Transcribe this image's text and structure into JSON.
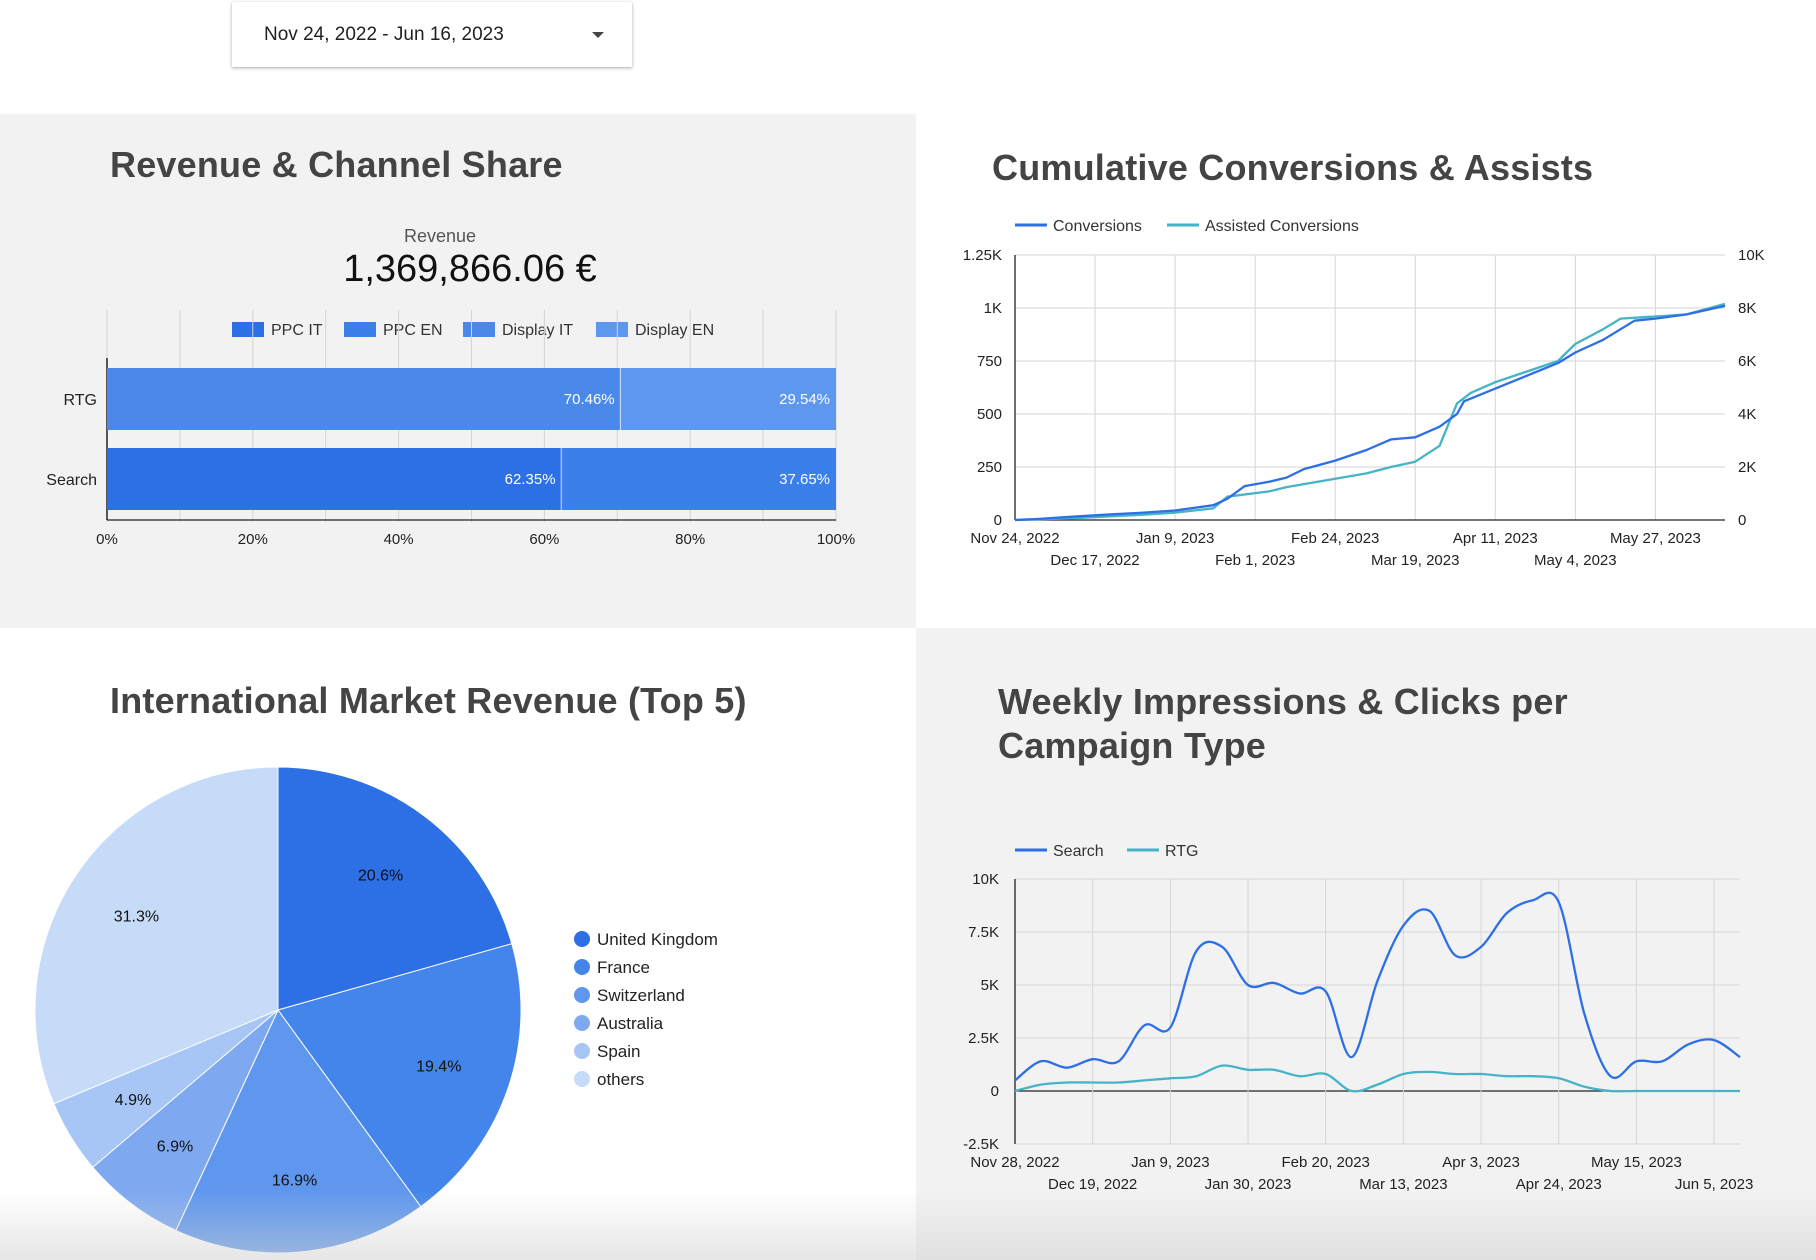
{
  "date_range": {
    "label": "Nov 24, 2022 - Jun 16, 2023"
  },
  "panels": {
    "revenue": {
      "title": "Revenue & Channel Share",
      "scorecard_label": "Revenue",
      "scorecard_value": "1,369,866.06 €"
    },
    "cumulative": {
      "title": "Cumulative Conversions & Assists"
    },
    "market": {
      "title": "International Market Revenue (Top 5)"
    },
    "weekly": {
      "title": "Weekly Impressions & Clicks per Campaign Type"
    }
  },
  "colors": {
    "ppc_it": "#2d6fe5",
    "ppc_en": "#3b7fe8",
    "display_it": "#4a89ea",
    "display_en": "#5e97ee",
    "conversions": "#2d6fe5",
    "assists": "#46b3c7",
    "search": "#2d6fe5",
    "rtg": "#46b3c7",
    "pie": [
      "#2d6fe5",
      "#4385ea",
      "#5f97ee",
      "#7ea9f0",
      "#a7c6f5",
      "#c6dbf8"
    ]
  },
  "chart_data": [
    {
      "id": "channel_share",
      "type": "bar",
      "orientation": "horizontal",
      "stacked": "percent",
      "legend": [
        "PPC IT",
        "PPC EN",
        "Display IT",
        "Display EN"
      ],
      "legend_position": "top",
      "categories": [
        "RTG",
        "Search"
      ],
      "rows": [
        {
          "category": "RTG",
          "segments": [
            {
              "series": "Display IT",
              "value": 70.46,
              "label": "70.46%"
            },
            {
              "series": "Display EN",
              "value": 29.54,
              "label": "29.54%"
            }
          ]
        },
        {
          "category": "Search",
          "segments": [
            {
              "series": "PPC IT",
              "value": 62.35,
              "label": "62.35%"
            },
            {
              "series": "PPC EN",
              "value": 37.65,
              "label": "37.65%"
            }
          ]
        }
      ],
      "x_ticks": [
        "0%",
        "20%",
        "40%",
        "60%",
        "80%",
        "100%"
      ],
      "xlim": [
        0,
        100
      ],
      "grid": true
    },
    {
      "id": "cumulative",
      "type": "line",
      "legend_position": "top-left",
      "series": [
        {
          "name": "Conversions",
          "axis": "left",
          "points": [
            [
              "2022-11-24",
              0
            ],
            [
              "2022-12-01",
              5
            ],
            [
              "2022-12-10",
              15
            ],
            [
              "2022-12-20",
              25
            ],
            [
              "2022-12-31",
              35
            ],
            [
              "2023-01-09",
              45
            ],
            [
              "2023-01-20",
              70
            ],
            [
              "2023-01-24",
              100
            ],
            [
              "2023-01-29",
              160
            ],
            [
              "2023-02-05",
              180
            ],
            [
              "2023-02-10",
              200
            ],
            [
              "2023-02-15",
              240
            ],
            [
              "2023-02-24",
              280
            ],
            [
              "2023-03-05",
              330
            ],
            [
              "2023-03-12",
              380
            ],
            [
              "2023-03-19",
              390
            ],
            [
              "2023-03-26",
              440
            ],
            [
              "2023-03-31",
              500
            ],
            [
              "2023-04-02",
              560
            ],
            [
              "2023-04-11",
              620
            ],
            [
              "2023-04-20",
              680
            ],
            [
              "2023-04-29",
              740
            ],
            [
              "2023-05-04",
              790
            ],
            [
              "2023-05-12",
              850
            ],
            [
              "2023-05-17",
              900
            ],
            [
              "2023-05-21",
              940
            ],
            [
              "2023-05-27",
              950
            ],
            [
              "2023-06-05",
              970
            ],
            [
              "2023-06-16",
              1010
            ]
          ]
        },
        {
          "name": "Assisted Conversions",
          "axis": "right",
          "points": [
            [
              "2022-11-24",
              0
            ],
            [
              "2022-12-10",
              60
            ],
            [
              "2022-12-31",
              200
            ],
            [
              "2023-01-09",
              280
            ],
            [
              "2023-01-20",
              440
            ],
            [
              "2023-01-24",
              880
            ],
            [
              "2023-02-05",
              1080
            ],
            [
              "2023-02-10",
              1240
            ],
            [
              "2023-02-24",
              1560
            ],
            [
              "2023-03-05",
              1760
            ],
            [
              "2023-03-12",
              2000
            ],
            [
              "2023-03-19",
              2200
            ],
            [
              "2023-03-26",
              2800
            ],
            [
              "2023-03-31",
              4400
            ],
            [
              "2023-04-04",
              4800
            ],
            [
              "2023-04-11",
              5200
            ],
            [
              "2023-04-20",
              5600
            ],
            [
              "2023-04-29",
              6000
            ],
            [
              "2023-05-04",
              6640
            ],
            [
              "2023-05-12",
              7200
            ],
            [
              "2023-05-17",
              7600
            ],
            [
              "2023-05-27",
              7680
            ],
            [
              "2023-06-05",
              7760
            ],
            [
              "2023-06-16",
              8160
            ]
          ]
        }
      ],
      "x_ticks_row1": [
        "Nov 24, 2022",
        "Jan 9, 2023",
        "Feb 24, 2023",
        "Apr 11, 2023",
        "May 27, 2023"
      ],
      "x_ticks_row2": [
        "Dec 17, 2022",
        "Feb 1, 2023",
        "Mar 19, 2023",
        "May 4, 2023"
      ],
      "y_left_ticks": [
        "0",
        "250",
        "500",
        "750",
        "1K",
        "1.25K"
      ],
      "y_right_ticks": [
        "0",
        "2K",
        "4K",
        "6K",
        "8K",
        "10K"
      ],
      "ylim_left": [
        0,
        1250
      ],
      "ylim_right": [
        0,
        10000
      ],
      "xlim": [
        "2022-11-24",
        "2023-06-16"
      ],
      "grid": true
    },
    {
      "id": "market_pie",
      "type": "pie",
      "legend_position": "right",
      "slices": [
        {
          "label": "United Kingdom",
          "value": 20.6,
          "text": "20.6%"
        },
        {
          "label": "France",
          "value": 19.4,
          "text": "19.4%"
        },
        {
          "label": "Switzerland",
          "value": 16.9,
          "text": "16.9%"
        },
        {
          "label": "Australia",
          "value": 6.9,
          "text": "6.9%"
        },
        {
          "label": "Spain",
          "value": 4.9,
          "text": "4.9%"
        },
        {
          "label": "others",
          "value": 31.3,
          "text": "31.3%"
        }
      ]
    },
    {
      "id": "weekly",
      "type": "line",
      "smooth": true,
      "legend_position": "top-left",
      "series": [
        {
          "name": "Search",
          "points": [
            [
              "2022-11-28",
              500
            ],
            [
              "2022-12-05",
              1400
            ],
            [
              "2022-12-12",
              1100
            ],
            [
              "2022-12-19",
              1500
            ],
            [
              "2022-12-26",
              1400
            ],
            [
              "2023-01-02",
              3100
            ],
            [
              "2023-01-09",
              3000
            ],
            [
              "2023-01-16",
              6600
            ],
            [
              "2023-01-23",
              6800
            ],
            [
              "2023-01-30",
              5000
            ],
            [
              "2023-02-06",
              5100
            ],
            [
              "2023-02-13",
              4600
            ],
            [
              "2023-02-20",
              4700
            ],
            [
              "2023-02-27",
              1600
            ],
            [
              "2023-03-06",
              5200
            ],
            [
              "2023-03-13",
              7800
            ],
            [
              "2023-03-20",
              8500
            ],
            [
              "2023-03-27",
              6400
            ],
            [
              "2023-04-03",
              6800
            ],
            [
              "2023-04-10",
              8400
            ],
            [
              "2023-04-17",
              9000
            ],
            [
              "2023-04-24",
              8900
            ],
            [
              "2023-05-01",
              3600
            ],
            [
              "2023-05-08",
              700
            ],
            [
              "2023-05-15",
              1400
            ],
            [
              "2023-05-22",
              1400
            ],
            [
              "2023-05-29",
              2200
            ],
            [
              "2023-06-05",
              2400
            ],
            [
              "2023-06-12",
              1600
            ]
          ]
        },
        {
          "name": "RTG",
          "points": [
            [
              "2022-11-28",
              0
            ],
            [
              "2022-12-05",
              300
            ],
            [
              "2022-12-12",
              400
            ],
            [
              "2022-12-19",
              400
            ],
            [
              "2022-12-26",
              400
            ],
            [
              "2023-01-02",
              500
            ],
            [
              "2023-01-09",
              600
            ],
            [
              "2023-01-16",
              700
            ],
            [
              "2023-01-23",
              1200
            ],
            [
              "2023-01-30",
              1000
            ],
            [
              "2023-02-06",
              1000
            ],
            [
              "2023-02-13",
              700
            ],
            [
              "2023-02-20",
              800
            ],
            [
              "2023-02-27",
              0
            ],
            [
              "2023-03-06",
              300
            ],
            [
              "2023-03-13",
              800
            ],
            [
              "2023-03-20",
              900
            ],
            [
              "2023-03-27",
              800
            ],
            [
              "2023-04-03",
              800
            ],
            [
              "2023-04-10",
              700
            ],
            [
              "2023-04-17",
              700
            ],
            [
              "2023-04-24",
              600
            ],
            [
              "2023-05-01",
              200
            ],
            [
              "2023-05-08",
              0
            ],
            [
              "2023-05-15",
              0
            ],
            [
              "2023-05-22",
              0
            ],
            [
              "2023-05-29",
              0
            ],
            [
              "2023-06-05",
              0
            ],
            [
              "2023-06-12",
              0
            ]
          ]
        }
      ],
      "x_ticks_row1": [
        "Nov 28, 2022",
        "Jan 9, 2023",
        "Feb 20, 2023",
        "Apr 3, 2023",
        "May 15, 2023"
      ],
      "x_ticks_row2": [
        "Dec 19, 2022",
        "Jan 30, 2023",
        "Mar 13, 2023",
        "Apr 24, 2023",
        "Jun 5, 2023"
      ],
      "y_ticks": [
        "-2.5K",
        "0",
        "2.5K",
        "5K",
        "7.5K",
        "10K"
      ],
      "ylim": [
        -2500,
        10000
      ],
      "xlim": [
        "2022-11-28",
        "2023-06-12"
      ],
      "grid": true
    }
  ]
}
